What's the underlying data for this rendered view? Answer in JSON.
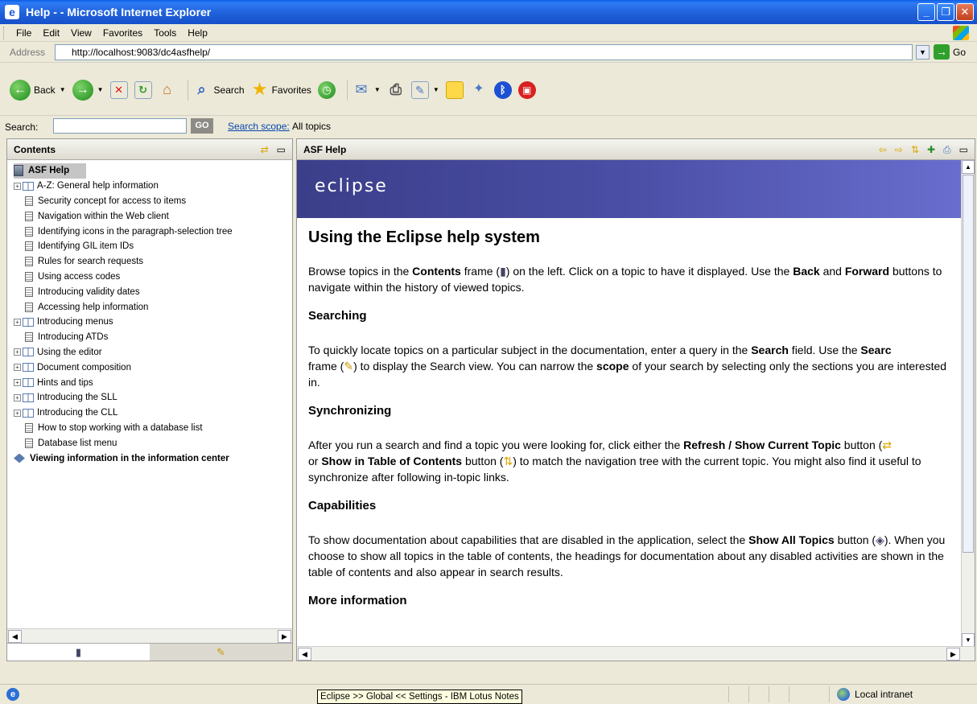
{
  "window": {
    "title": "Help - - Microsoft Internet Explorer"
  },
  "menu": [
    "File",
    "Edit",
    "View",
    "Favorites",
    "Tools",
    "Help"
  ],
  "address": {
    "label": "Address",
    "url": "http://localhost:9083/dc4asfhelp/",
    "go_label": "Go"
  },
  "toolbar": {
    "back_label": "Back",
    "search_label": "Search",
    "favorites_label": "Favorites"
  },
  "help_search": {
    "label": "Search:",
    "go_label": "GO",
    "scope_link": "Search scope:",
    "scope_value": "All topics"
  },
  "contents": {
    "title": "Contents",
    "root": "ASF Help",
    "items": [
      {
        "label": "A-Z: General help information",
        "type": "book"
      },
      {
        "label": "Security concept for access to items",
        "type": "page"
      },
      {
        "label": "Navigation within the Web client",
        "type": "page"
      },
      {
        "label": "Identifying icons in the paragraph-selection tree",
        "type": "page"
      },
      {
        "label": "Identifying GIL item IDs",
        "type": "page"
      },
      {
        "label": "Rules for search requests",
        "type": "page"
      },
      {
        "label": "Using access codes",
        "type": "page"
      },
      {
        "label": "Introducing validity dates",
        "type": "page"
      },
      {
        "label": "Accessing help information",
        "type": "page"
      },
      {
        "label": "Introducing menus",
        "type": "book"
      },
      {
        "label": "Introducing ATDs",
        "type": "page"
      },
      {
        "label": "Using the editor",
        "type": "book"
      },
      {
        "label": "Document composition",
        "type": "book"
      },
      {
        "label": "Hints and tips",
        "type": "book"
      },
      {
        "label": "Introducing the SLL",
        "type": "book"
      },
      {
        "label": "Introducing the CLL",
        "type": "book"
      },
      {
        "label": "How to stop working with a database list",
        "type": "page"
      },
      {
        "label": "Database list menu",
        "type": "page"
      }
    ],
    "footer_item": "Viewing information in the information center"
  },
  "topic": {
    "pane_title": "ASF Help",
    "banner_logo": "eclipse",
    "title": "Using the Eclipse help system",
    "sections": {
      "intro": {
        "t1": "Browse topics in the ",
        "b1": "Contents",
        "t2": " frame (",
        "t3": ") on the left. Click on a topic to have it displayed. Use the ",
        "b2": "Back",
        "t4": " and ",
        "b3": "Forward",
        "t5": " buttons to navigate within the history of viewed topics."
      },
      "searching": {
        "heading": "Searching",
        "t1": "To quickly locate topics on a particular subject in the documentation, enter a query in the ",
        "b1": "Search",
        "t2": " field. Use the ",
        "b2": "Searc",
        "t3": "frame (",
        "t4": ") to display the Search view. You can narrow the ",
        "b3": "scope",
        "t5": " of your search by selecting only the sections you are interested in."
      },
      "sync": {
        "heading": "Synchronizing",
        "t1": "After you run a search and find a topic you were looking for, click either the ",
        "b1": "Refresh / Show Current Topic",
        "t2": " button (",
        "t3": " or ",
        "b2": "Show in Table of Contents",
        "t4": " button (",
        "t5": ") to match the navigation tree with the current topic. You might also find it useful to synchronize after following in-topic links."
      },
      "capabilities": {
        "heading": "Capabilities",
        "t1": "To show documentation about capabilities that are disabled in the application, select the ",
        "b1": "Show All Topics",
        "t2": " button (",
        "t3": "). When you choose to show all topics in the table of contents, the headings for documentation about any disabled activities are shown in the table of contents and also appear in search results."
      },
      "more": {
        "heading": "More information"
      }
    }
  },
  "status": {
    "tooltip": "Eclipse >> Global << Settings - IBM Lotus Notes",
    "zone": "Local intranet"
  }
}
